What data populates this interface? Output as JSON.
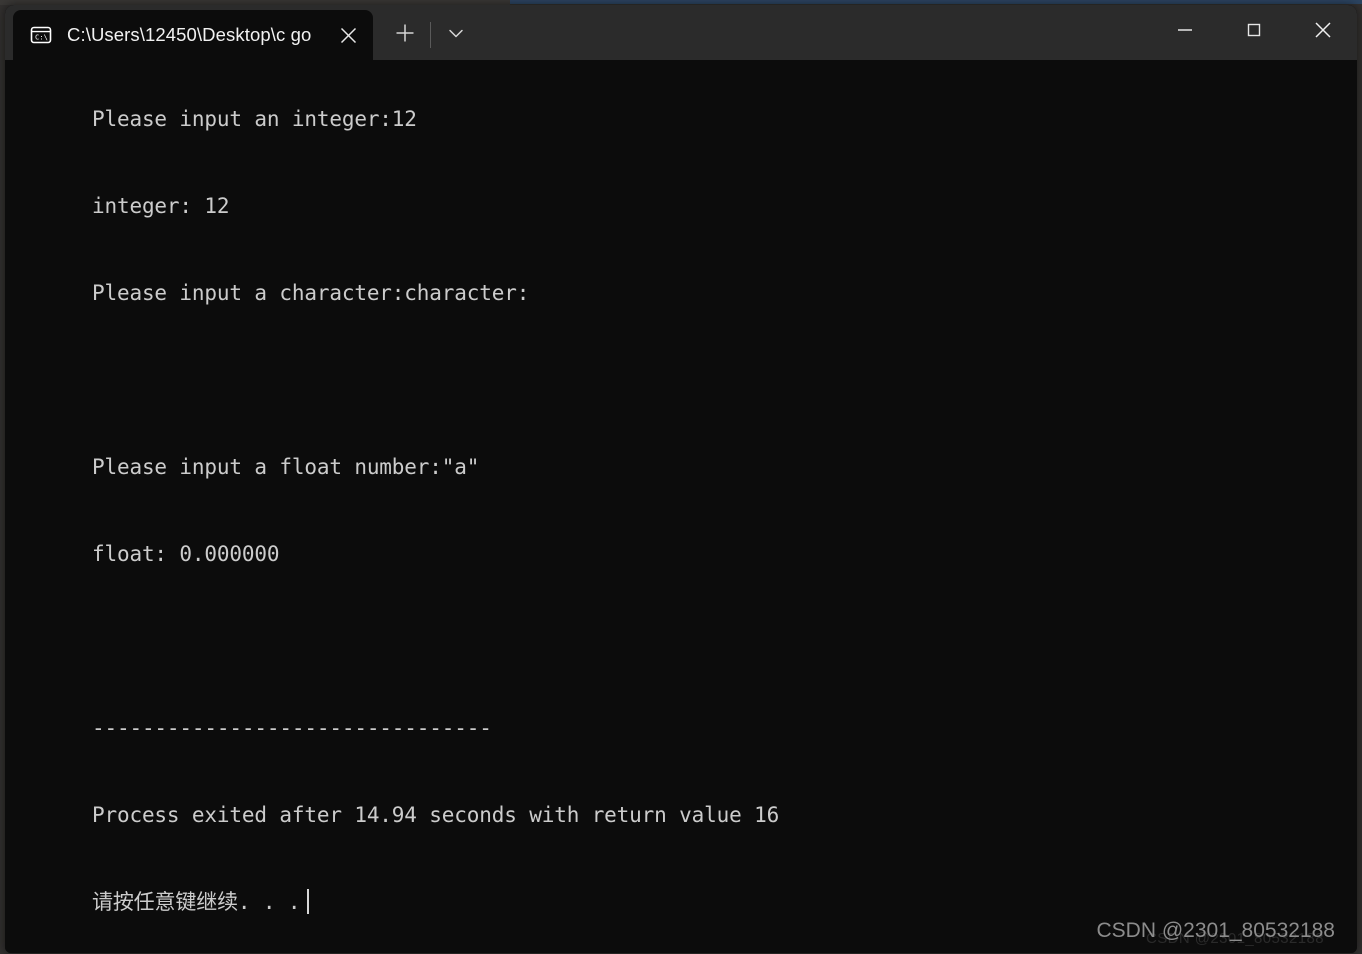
{
  "window": {
    "title_bar_color": "#2b2b2b",
    "body_color": "#0c0c0c",
    "text_color": "#cccccc"
  },
  "tab": {
    "icon": "command-prompt-icon",
    "label": "C:\\Users\\12450\\Desktop\\c go",
    "close_icon": "close-icon",
    "new_tab_icon": "plus-icon",
    "dropdown_icon": "chevron-down-icon"
  },
  "window_controls": {
    "minimize_icon": "minimize-icon",
    "maximize_icon": "maximize-icon",
    "close_icon": "close-icon"
  },
  "console": {
    "lines": [
      "Please input an integer:12",
      "integer: 12",
      "Please input a character:character:",
      "",
      "Please input a float number:\"a\"",
      "float: 0.000000",
      "",
      "--------------------------------",
      "Process exited after 14.94 seconds with return value 16",
      "请按任意键继续. . ."
    ],
    "prompt_integer": "Please input an integer:",
    "entered_integer": "12",
    "echo_integer": "integer: 12",
    "prompt_character": "Please input a character:character:",
    "prompt_float": "Please input a float number:\"a\"",
    "echo_float": "float: 0.000000",
    "separator": "--------------------------------",
    "exit_message": "Process exited after 14.94 seconds with return value 16",
    "exit_seconds": "14.94",
    "return_value": "16",
    "press_any_key": "请按任意键继续. . .",
    "cursor_visible": true
  },
  "watermark": {
    "text": "CSDN @2301_80532188",
    "ghost_text": "CSDN @2301_80532188"
  }
}
